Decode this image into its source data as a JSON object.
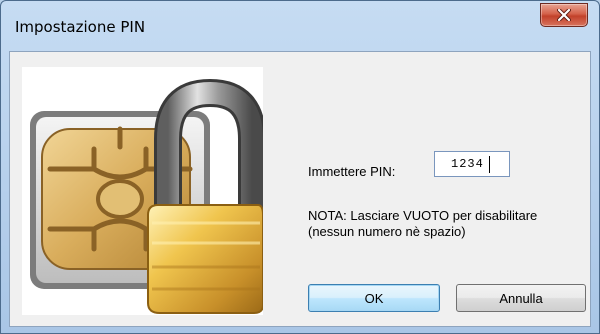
{
  "window": {
    "title": "Impostazione PIN",
    "close_icon": "close-x-icon"
  },
  "image": {
    "icon": "sim-card-padlock-icon"
  },
  "pin": {
    "label": "Immettere PIN:",
    "value": "1234"
  },
  "note": {
    "line1": "NOTA: Lasciare VUOTO per disabilitare",
    "line2": "(nessun numero nè spazio)"
  },
  "buttons": {
    "ok_label": "OK",
    "cancel_label": "Annulla"
  },
  "colors": {
    "title_bar": "#b9d1ea",
    "close_button": "#c7503a",
    "sim_chip": "#d9b46a",
    "padlock_body": "#e0b245"
  }
}
